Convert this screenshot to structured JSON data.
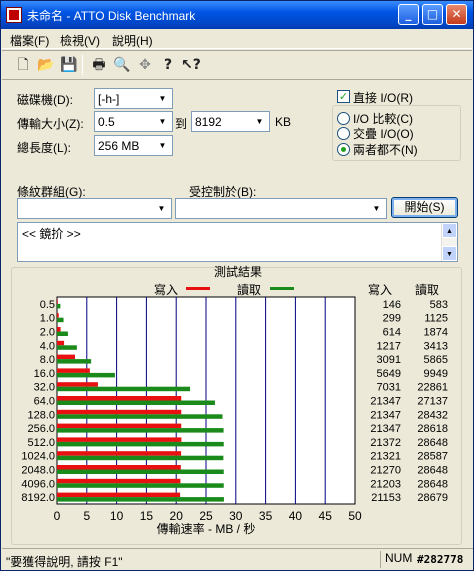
{
  "window": {
    "title": "未命名 - ATTO Disk Benchmark",
    "minimize": "_",
    "maximize": "□",
    "close": "✕"
  },
  "menu": {
    "items": [
      "檔案(F)",
      "檢視(V)",
      "說明(H)"
    ]
  },
  "toolbar": {
    "icons": [
      "new-icon",
      "open-icon",
      "save-icon",
      "print-icon",
      "print-preview-icon",
      "move-icon",
      "help-icon",
      "context-help-icon"
    ]
  },
  "form": {
    "drive_label": "磁碟機(D):",
    "drive_value": "[-h-]",
    "transfer_label": "傳輸大小(Z):",
    "transfer_from": "0.5",
    "transfer_to_label": "到",
    "transfer_to": "8192",
    "transfer_unit": "KB",
    "total_label": "總長度(L):",
    "total_value": "256 MB",
    "direct_io_label": "直接 I/O(R)",
    "direct_io_checked": true,
    "io_options": [
      "I/O 比較(C)",
      "交疊 I/O(O)",
      "兩者都不(N)"
    ],
    "io_selected": 2,
    "stripe_label": "條紋群組(G):",
    "control_label": "受控制於(B):",
    "start_button": "開始(S)",
    "notes_text": "<< 鏡扴 >>"
  },
  "results": {
    "title": "測試結果",
    "write_label": "寫入",
    "read_label": "讀取",
    "write_color": "#e81010",
    "read_color": "#1a8a1a",
    "col_write": "寫入",
    "col_read": "讀取"
  },
  "chart_data": {
    "type": "bar",
    "categories": [
      "0.5",
      "1.0",
      "2.0",
      "4.0",
      "8.0",
      "16.0",
      "32.0",
      "64.0",
      "128.0",
      "256.0",
      "512.0",
      "1024.0",
      "2048.0",
      "4096.0",
      "8192.0"
    ],
    "series": [
      {
        "name": "寫入",
        "values": [
          146,
          299,
          614,
          1217,
          3091,
          5649,
          7031,
          21347,
          21347,
          21347,
          21372,
          21321,
          21270,
          21203,
          21153
        ]
      },
      {
        "name": "讀取",
        "values": [
          583,
          1125,
          1874,
          3413,
          5865,
          9949,
          22861,
          27137,
          28432,
          28618,
          28648,
          28587,
          28648,
          28648,
          28679
        ]
      }
    ],
    "xlabel": "傳輸速率 - MB / 秒",
    "xlim": [
      0,
      50
    ],
    "xticks": [
      "0",
      "5",
      "10",
      "15",
      "20",
      "25",
      "30",
      "35",
      "40",
      "45",
      "50"
    ],
    "orientation": "horizontal",
    "grid": true
  },
  "status": {
    "text": "\"要獲得說明, 請按 F1\"",
    "num": "NUM",
    "id": "#282778"
  }
}
